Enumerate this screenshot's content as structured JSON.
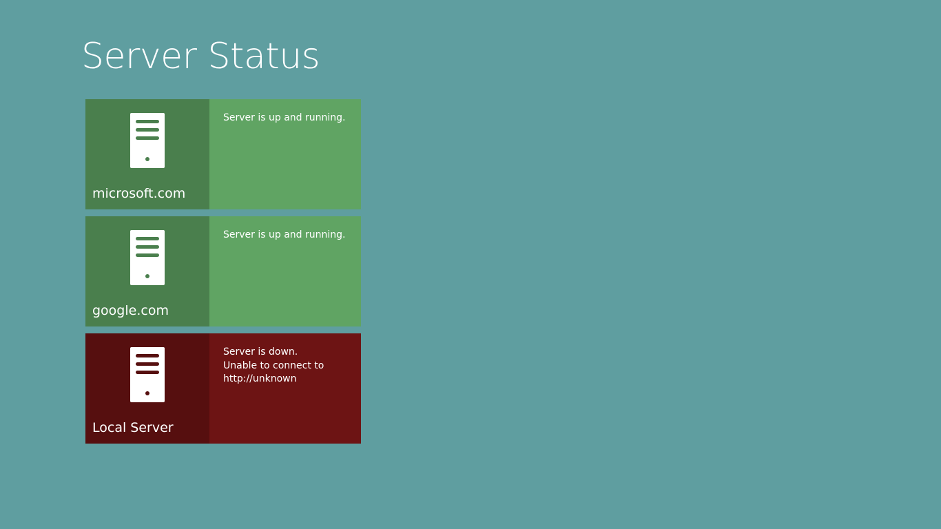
{
  "page": {
    "title": "Server Status",
    "background_color": "#5f9ea0"
  },
  "servers": [
    {
      "name": "microsoft.com",
      "status": "up",
      "status_lines": [
        "Server is up and running."
      ],
      "icon": "server-icon",
      "colors": {
        "dark": "#4a7f4d",
        "light": "#60a463"
      }
    },
    {
      "name": "google.com",
      "status": "up",
      "status_lines": [
        "Server is up and running."
      ],
      "icon": "server-icon",
      "colors": {
        "dark": "#4a7f4d",
        "light": "#60a463"
      }
    },
    {
      "name": "Local Server",
      "status": "down",
      "status_lines": [
        "Server is down.",
        "Unable to connect to",
        "http://unknown"
      ],
      "icon": "server-icon",
      "colors": {
        "dark": "#560f0f",
        "light": "#6d1414"
      }
    }
  ]
}
